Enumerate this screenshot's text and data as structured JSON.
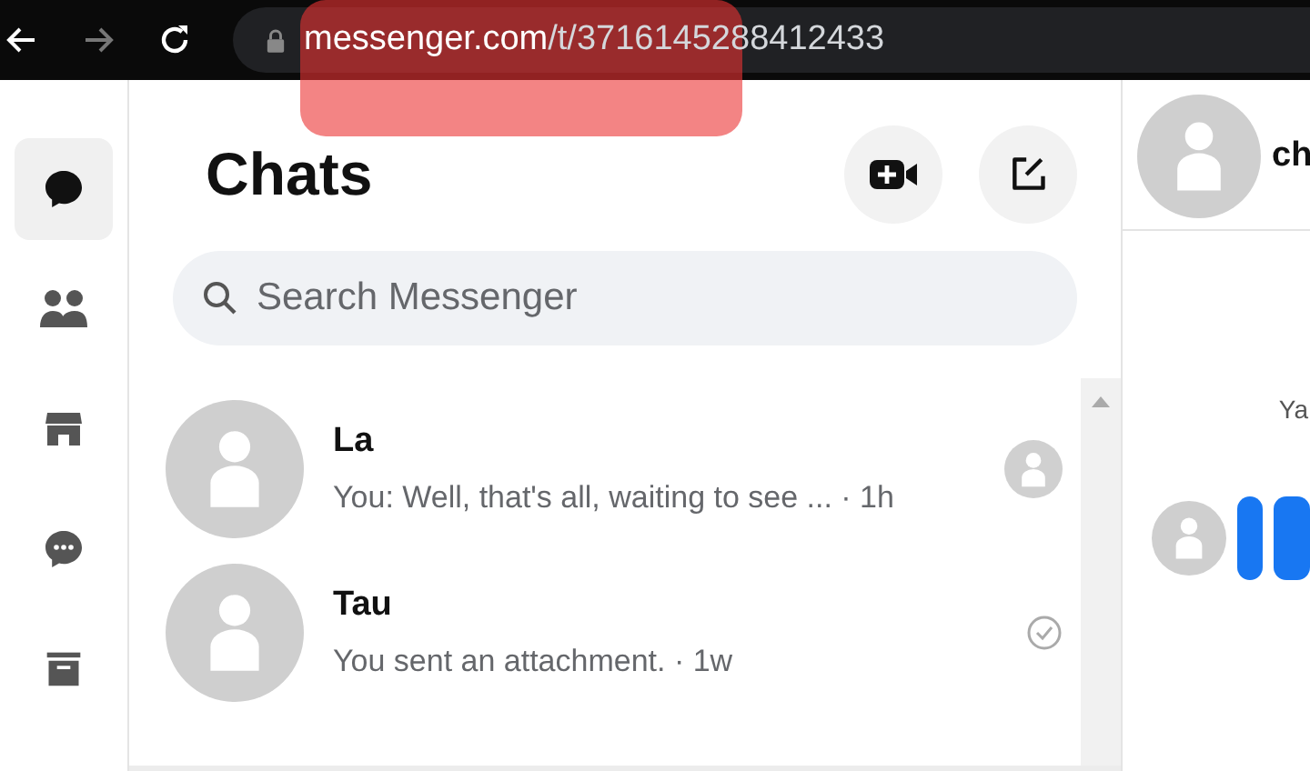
{
  "browser": {
    "url_domain": "messenger.com",
    "url_path": "/t/3716145288412433",
    "url_highlight": true
  },
  "sidebar": {
    "items": [
      {
        "kind": "chats",
        "selected": true
      },
      {
        "kind": "people",
        "selected": false
      },
      {
        "kind": "marketplace",
        "selected": false
      },
      {
        "kind": "requests",
        "selected": false
      },
      {
        "kind": "archive",
        "selected": false
      }
    ]
  },
  "chat_list": {
    "title": "Chats",
    "search": {
      "placeholder": "Search Messenger"
    },
    "rows": [
      {
        "name": "La",
        "preview": "You: Well, that's all, waiting to see ... · 1h",
        "kind": "seen"
      },
      {
        "name": "Tau",
        "preview": "You sent an attachment. · 1w",
        "kind": "sent"
      }
    ]
  },
  "conversation": {
    "header_name": "ch",
    "message_text": "Ya"
  }
}
